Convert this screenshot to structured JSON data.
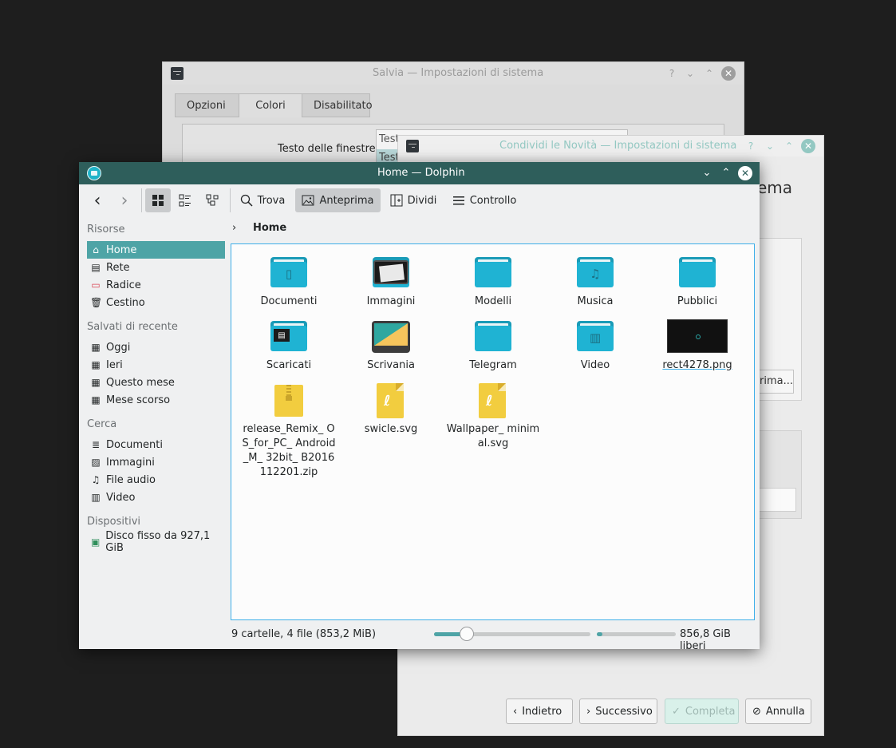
{
  "salvia": {
    "title": "Salvia — Impostazioni di sistema",
    "tabs": [
      "Opzioni",
      "Colori",
      "Disabilitato"
    ],
    "row_label": "Testo delle finestre",
    "combo_line1": "Test",
    "combo_line2": "Test"
  },
  "condividi": {
    "title": "Condividi le Novità — Impostazioni di sistema",
    "heading_fragment": "ema",
    "button_fragment": "rima...",
    "footer": {
      "back": "Indietro",
      "next": "Successivo",
      "finish": "Completa",
      "cancel": "Annulla"
    }
  },
  "dolphin": {
    "title": "Home — Dolphin",
    "toolbar": {
      "find": "Trova",
      "preview": "Anteprima",
      "split": "Dividi",
      "control": "Controllo"
    },
    "sidebar": {
      "places_header": "Risorse",
      "places": [
        {
          "label": "Home",
          "icon": "home-icon"
        },
        {
          "label": "Rete",
          "icon": "network-icon"
        },
        {
          "label": "Radice",
          "icon": "root-folder-icon"
        },
        {
          "label": "Cestino",
          "icon": "trash-icon"
        }
      ],
      "recent_header": "Salvati di recente",
      "recent": [
        {
          "label": "Oggi",
          "icon": "calendar-icon"
        },
        {
          "label": "Ieri",
          "icon": "calendar-icon"
        },
        {
          "label": "Questo mese",
          "icon": "calendar-icon"
        },
        {
          "label": "Mese scorso",
          "icon": "calendar-icon"
        }
      ],
      "search_header": "Cerca",
      "search": [
        {
          "label": "Documenti",
          "icon": "document-icon"
        },
        {
          "label": "Immagini",
          "icon": "image-icon"
        },
        {
          "label": "File audio",
          "icon": "music-icon"
        },
        {
          "label": "Video",
          "icon": "video-icon"
        }
      ],
      "devices_header": "Dispositivi",
      "devices": [
        {
          "label": "Disco fisso da 927,1 GiB",
          "icon": "hard-disk-icon"
        }
      ]
    },
    "breadcrumb": "Home",
    "files": [
      {
        "name": "Documenti",
        "kind": "folder",
        "emblem": "document-icon"
      },
      {
        "name": "Immagini",
        "kind": "image-folder"
      },
      {
        "name": "Modelli",
        "kind": "folder",
        "emblem": ""
      },
      {
        "name": "Musica",
        "kind": "folder",
        "emblem": "music-icon"
      },
      {
        "name": "Pubblici",
        "kind": "folder",
        "emblem": ""
      },
      {
        "name": "Scaricati",
        "kind": "folder",
        "emblem": "download-icon"
      },
      {
        "name": "Scrivania",
        "kind": "desktop-folder"
      },
      {
        "name": "Telegram",
        "kind": "folder",
        "emblem": ""
      },
      {
        "name": "Video",
        "kind": "folder",
        "emblem": "video-icon"
      },
      {
        "name": "rect4278.png",
        "kind": "png"
      },
      {
        "name": "release_Remix_ OS_for_PC_ Android_M_ 32bit_ B2016112201.zip",
        "kind": "zip"
      },
      {
        "name": "swicle.svg",
        "kind": "svg"
      },
      {
        "name": "Wallpaper_ minimal.svg",
        "kind": "svg"
      }
    ],
    "status": "9 cartelle, 4 file (853,2 MiB)",
    "zoom_level": 0.21,
    "disk_used_fraction": 0.07,
    "free_space": "856,8 GiB liberi"
  }
}
